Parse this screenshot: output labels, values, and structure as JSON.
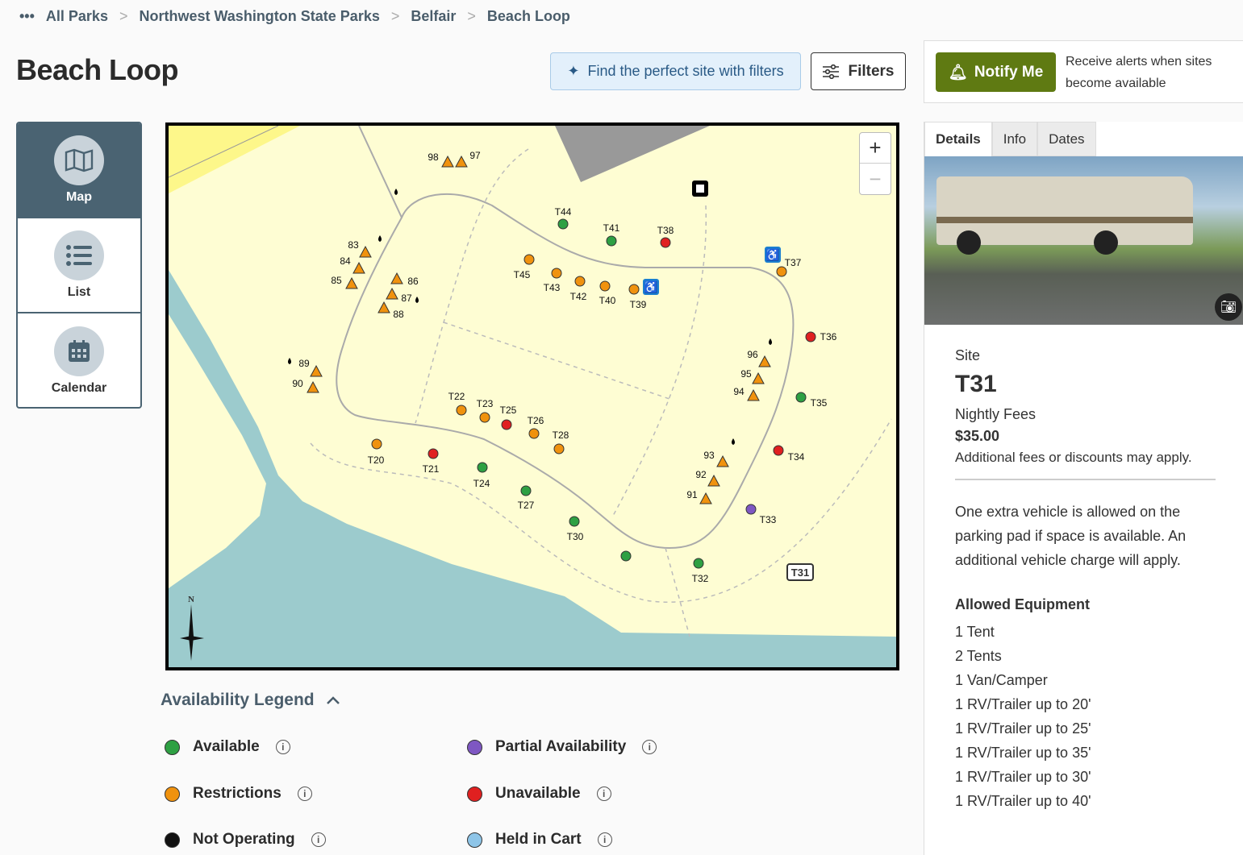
{
  "breadcrumb": {
    "more": "•••",
    "items": [
      "All Parks",
      "Northwest Washington State Parks",
      "Belfair",
      "Beach Loop"
    ]
  },
  "page_title": "Beach Loop",
  "toolbar": {
    "find_label": "Find the perfect site with filters",
    "filters_label": "Filters"
  },
  "notify": {
    "button_label": "Notify Me",
    "text": "Receive alerts when sites become available"
  },
  "views": [
    {
      "label": "Map",
      "icon": "map-icon"
    },
    {
      "label": "List",
      "icon": "list-icon"
    },
    {
      "label": "Calendar",
      "icon": "calendar-icon"
    }
  ],
  "colors": {
    "available": "#2ea043",
    "restrictions": "#f0920e",
    "unavailable": "#e02020",
    "partial": "#7e57c2",
    "not_operating": "#111111",
    "held": "#8ec5e8",
    "primary": "#4a6372",
    "notify": "#5f7a12"
  },
  "map": {
    "zoom_in": "+",
    "zoom_out": "−",
    "north": "N",
    "selected_label": "T31",
    "sites": [
      {
        "id": "98",
        "type": "triangle",
        "status": "restrictions"
      },
      {
        "id": "97",
        "type": "triangle",
        "status": "restrictions"
      },
      {
        "id": "83",
        "type": "triangle",
        "status": "restrictions"
      },
      {
        "id": "84",
        "type": "triangle",
        "status": "restrictions"
      },
      {
        "id": "85",
        "type": "triangle",
        "status": "restrictions"
      },
      {
        "id": "86",
        "type": "triangle",
        "status": "restrictions"
      },
      {
        "id": "87",
        "type": "triangle",
        "status": "restrictions"
      },
      {
        "id": "88",
        "type": "triangle",
        "status": "restrictions"
      },
      {
        "id": "89",
        "type": "triangle",
        "status": "restrictions"
      },
      {
        "id": "90",
        "type": "triangle",
        "status": "restrictions"
      },
      {
        "id": "96",
        "type": "triangle",
        "status": "restrictions"
      },
      {
        "id": "95",
        "type": "triangle",
        "status": "restrictions"
      },
      {
        "id": "94",
        "type": "triangle",
        "status": "restrictions"
      },
      {
        "id": "93",
        "type": "triangle",
        "status": "restrictions"
      },
      {
        "id": "92",
        "type": "triangle",
        "status": "restrictions"
      },
      {
        "id": "91",
        "type": "triangle",
        "status": "restrictions"
      },
      {
        "id": "T44",
        "type": "circle",
        "status": "available"
      },
      {
        "id": "T41",
        "type": "circle",
        "status": "available"
      },
      {
        "id": "T38",
        "type": "circle",
        "status": "unavailable"
      },
      {
        "id": "T45",
        "type": "circle",
        "status": "restrictions"
      },
      {
        "id": "T43",
        "type": "circle",
        "status": "restrictions"
      },
      {
        "id": "T42",
        "type": "circle",
        "status": "restrictions"
      },
      {
        "id": "T40",
        "type": "circle",
        "status": "restrictions"
      },
      {
        "id": "T39",
        "type": "circle",
        "status": "restrictions"
      },
      {
        "id": "T37",
        "type": "circle",
        "status": "restrictions"
      },
      {
        "id": "T36",
        "type": "circle",
        "status": "unavailable"
      },
      {
        "id": "T35",
        "type": "circle",
        "status": "available"
      },
      {
        "id": "T34",
        "type": "circle",
        "status": "unavailable"
      },
      {
        "id": "T33",
        "type": "circle",
        "status": "partial"
      },
      {
        "id": "T32",
        "type": "circle",
        "status": "available"
      },
      {
        "id": "T31",
        "type": "circle",
        "status": "available"
      },
      {
        "id": "T30",
        "type": "circle",
        "status": "available"
      },
      {
        "id": "T27",
        "type": "circle",
        "status": "available"
      },
      {
        "id": "T24",
        "type": "circle",
        "status": "available"
      },
      {
        "id": "T21",
        "type": "circle",
        "status": "unavailable"
      },
      {
        "id": "T20",
        "type": "circle",
        "status": "restrictions"
      },
      {
        "id": "T22",
        "type": "circle",
        "status": "restrictions"
      },
      {
        "id": "T23",
        "type": "circle",
        "status": "restrictions"
      },
      {
        "id": "T25",
        "type": "circle",
        "status": "unavailable"
      },
      {
        "id": "T26",
        "type": "circle",
        "status": "restrictions"
      },
      {
        "id": "T28",
        "type": "circle",
        "status": "restrictions"
      }
    ]
  },
  "legend": {
    "title": "Availability Legend",
    "items": [
      {
        "label": "Available",
        "status": "available"
      },
      {
        "label": "Partial Availability",
        "status": "partial"
      },
      {
        "label": "Restrictions",
        "status": "restrictions"
      },
      {
        "label": "Unavailable",
        "status": "unavailable"
      },
      {
        "label": "Not Operating",
        "status": "not_operating"
      },
      {
        "label": "Held in Cart",
        "status": "held"
      }
    ],
    "info": "i"
  },
  "side": {
    "tabs": [
      "Details",
      "Info",
      "Dates"
    ],
    "site_label": "Site",
    "site_id": "T31",
    "fees_label": "Nightly Fees",
    "fee": "$35.00",
    "fee_note": "Additional fees or discounts may apply.",
    "vehicle_note": "One extra vehicle is allowed on the parking pad if space is available. An additional vehicle charge will apply.",
    "equipment_title": "Allowed Equipment",
    "equipment": [
      "1 Tent",
      "2 Tents",
      "1 Van/Camper",
      "1 RV/Trailer up to 20'",
      "1 RV/Trailer up to 25'",
      "1 RV/Trailer up to 35'",
      "1 RV/Trailer up to 30'",
      "1 RV/Trailer up to 40'"
    ]
  }
}
